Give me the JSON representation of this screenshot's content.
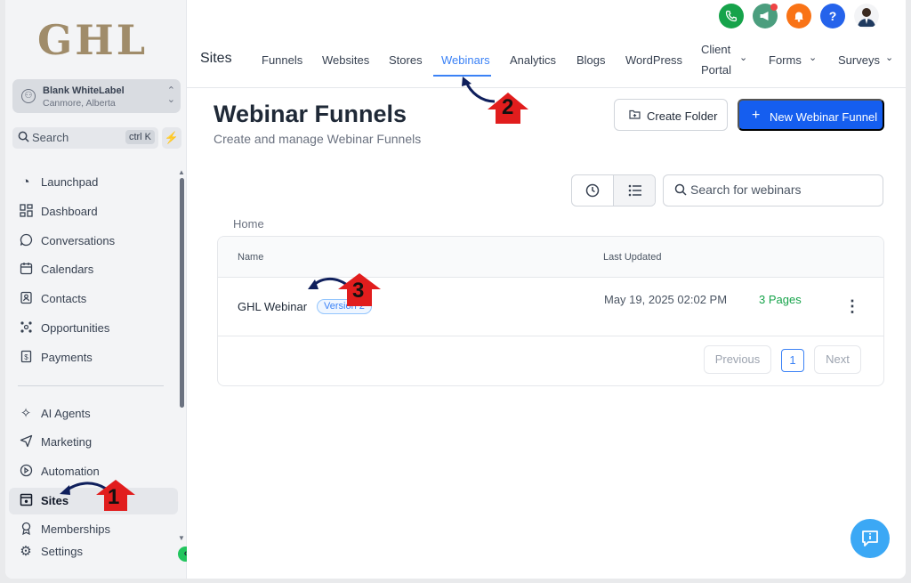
{
  "sidebar": {
    "logo": "GHL",
    "account": {
      "name": "Blank WhiteLabel",
      "location": "Canmore, Alberta"
    },
    "search": {
      "label": "Search",
      "shortcut": "ctrl K"
    },
    "items": [
      {
        "label": "Launchpad",
        "icon": "rocket-icon"
      },
      {
        "label": "Dashboard",
        "icon": "grid-icon"
      },
      {
        "label": "Conversations",
        "icon": "chat-icon"
      },
      {
        "label": "Calendars",
        "icon": "calendar-icon"
      },
      {
        "label": "Contacts",
        "icon": "contacts-icon"
      },
      {
        "label": "Opportunities",
        "icon": "opportunities-icon"
      },
      {
        "label": "Payments",
        "icon": "payments-icon"
      },
      {
        "label": "AI Agents",
        "icon": "sparkle-icon"
      },
      {
        "label": "Marketing",
        "icon": "send-icon"
      },
      {
        "label": "Automation",
        "icon": "automation-icon"
      },
      {
        "label": "Sites",
        "icon": "sites-icon",
        "active": true
      },
      {
        "label": "Memberships",
        "icon": "membership-icon"
      },
      {
        "label": "Settings",
        "icon": "gear-icon"
      }
    ]
  },
  "header": {
    "section_title": "Sites",
    "tabs": [
      {
        "label": "Funnels"
      },
      {
        "label": "Websites"
      },
      {
        "label": "Stores"
      },
      {
        "label": "Webinars",
        "active": true
      },
      {
        "label": "Analytics"
      },
      {
        "label": "Blogs"
      },
      {
        "label": "WordPress"
      },
      {
        "label": "Client Portal",
        "line1": "Client",
        "line2": "Portal"
      },
      {
        "label": "Forms"
      },
      {
        "label": "Surveys"
      }
    ],
    "icons": [
      "phone-icon",
      "megaphone-icon",
      "bell-icon",
      "help-icon",
      "avatar"
    ],
    "colors": {
      "phone": "#16a34a",
      "megaphone": "#4b9e7e",
      "bell": "#f97316",
      "help": "#2563eb",
      "accent": "#3b82f6"
    }
  },
  "main": {
    "title": "Webinar Funnels",
    "subtitle": "Create and manage Webinar Funnels",
    "create_folder_label": "Create Folder",
    "new_funnel_label": "New Webinar Funnel",
    "search_placeholder": "Search for webinars",
    "breadcrumb": "Home",
    "table": {
      "columns": [
        "Name",
        "Last Updated"
      ],
      "rows": [
        {
          "name": "GHL Webinar",
          "badge": "Version 2",
          "updated": "May 19, 2025 02:02 PM",
          "pages": "3 Pages"
        }
      ]
    },
    "pagination": {
      "previous": "Previous",
      "current": "1",
      "next": "Next"
    }
  },
  "annotations": [
    "1",
    "2",
    "3"
  ]
}
